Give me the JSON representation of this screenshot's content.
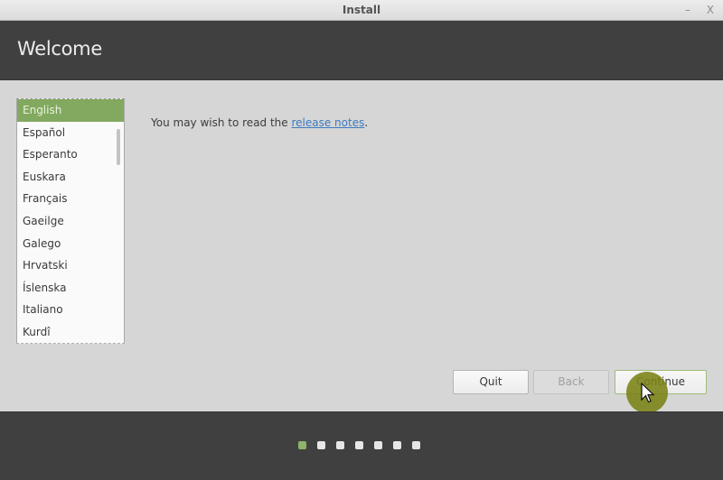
{
  "window": {
    "title": "Install",
    "minimize_label": "–",
    "close_label": "X"
  },
  "header": {
    "title": "Welcome"
  },
  "languages": {
    "selected": "English",
    "items": [
      "English",
      "Español",
      "Esperanto",
      "Euskara",
      "Français",
      "Gaeilge",
      "Galego",
      "Hrvatski",
      "Íslenska",
      "Italiano",
      "Kurdî"
    ]
  },
  "notes": {
    "prefix": "You may wish to read the ",
    "link": "release notes",
    "suffix": "."
  },
  "buttons": {
    "quit": "Quit",
    "back": "Back",
    "continue": "Continue"
  },
  "progress": {
    "total_steps": 7,
    "current_step": 1
  },
  "colors": {
    "accent": "#82a960",
    "header_bg": "#404040",
    "link": "#3d79bf"
  }
}
